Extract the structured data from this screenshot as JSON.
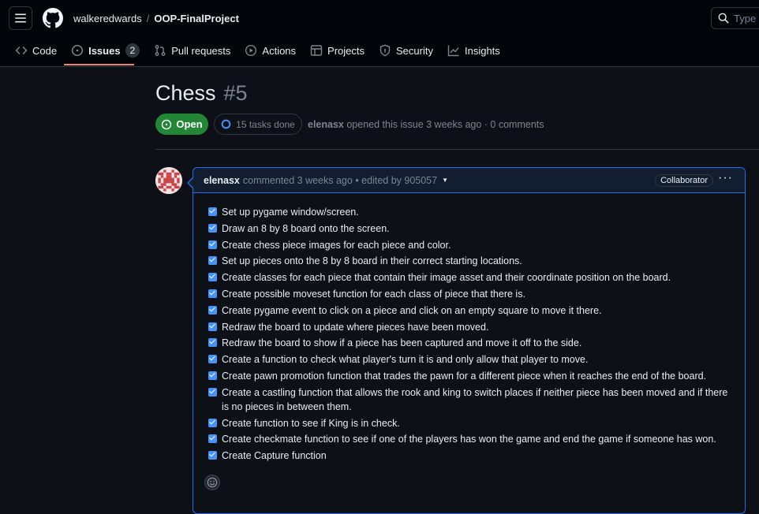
{
  "header": {
    "owner": "walkeredwards",
    "separator": "/",
    "repo": "OOP-FinalProject",
    "search_placeholder": "Type",
    "search_kbd": "/"
  },
  "tabs": [
    {
      "label": "Code",
      "icon": "code-icon"
    },
    {
      "label": "Issues",
      "icon": "issue-opened-icon",
      "count": "2",
      "active": true
    },
    {
      "label": "Pull requests",
      "icon": "git-pull-request-icon"
    },
    {
      "label": "Actions",
      "icon": "play-icon"
    },
    {
      "label": "Projects",
      "icon": "table-icon"
    },
    {
      "label": "Security",
      "icon": "shield-icon"
    },
    {
      "label": "Insights",
      "icon": "graph-icon"
    }
  ],
  "issue": {
    "title": "Chess",
    "number": "#5",
    "state": "Open",
    "tasks_status": "15 tasks done",
    "author": "elenasx",
    "meta": "opened this issue 3 weeks ago · 0 comments"
  },
  "comment": {
    "author": "elenasx",
    "meta": "commented 3 weeks ago • edited by 905057",
    "badge": "Collaborator",
    "menu": "···",
    "tasks": [
      {
        "text": "Set up pygame window/screen.",
        "checked": true
      },
      {
        "text": "Draw an 8 by 8 board onto the screen.",
        "checked": true
      },
      {
        "text": "Create chess piece images for each piece and color.",
        "checked": true
      },
      {
        "text": "Set up pieces onto the 8 by 8 board in their correct starting locations.",
        "checked": true
      },
      {
        "text": "Create classes for each piece that contain their image asset and their coordinate position on the board.",
        "checked": true
      },
      {
        "text": "Create possible moveset function for each class of piece that there is.",
        "checked": true
      },
      {
        "text": "Create pygame event to click on a piece and click on an empty square to move it there.",
        "checked": true
      },
      {
        "text": "Redraw the board to update where pieces have been moved.",
        "checked": true
      },
      {
        "text": "Redraw the board to show if a piece has been captured and move it off to the side.",
        "checked": true
      },
      {
        "text": "Create a function to check what player's turn it is and only allow that player to move.",
        "checked": true
      },
      {
        "text": "Create pawn promotion function that trades the pawn for a different piece when it reaches the end of the board.",
        "checked": true
      },
      {
        "text": "Create a castling function that allows the rook and king to switch places if neither piece has been moved and if there is no pieces in between them.",
        "checked": true
      },
      {
        "text": "Create function to see if King is in check.",
        "checked": true
      },
      {
        "text": "Create checkmate function to see if one of the players has won the game and end the game if someone has won.",
        "checked": true
      },
      {
        "text": "Create Capture function",
        "checked": true
      }
    ]
  },
  "colors": {
    "background": "#0d1117",
    "header_bg": "#010409",
    "accent_blue": "#1f6feb",
    "open_green": "#238636",
    "tab_underline": "#f78166",
    "checkbox": "#4493f8"
  }
}
